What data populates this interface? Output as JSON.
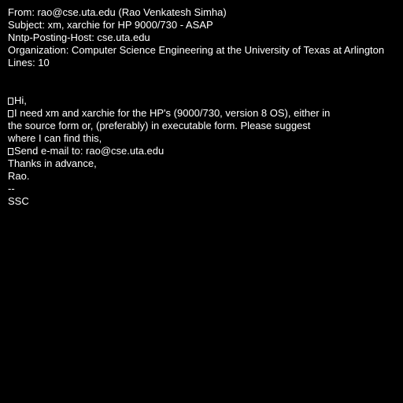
{
  "header": {
    "from": "From: rao@cse.uta.edu (Rao Venkatesh Simha)",
    "subject": "Subject: xm, xarchie for HP 9000/730 - ASAP",
    "nntp_host": "Nntp-Posting-Host: cse.uta.edu",
    "organization": "Organization: Computer Science Engineering at the University of Texas at Arlington",
    "lines": "Lines: 10"
  },
  "body": {
    "greeting": "Hi,",
    "request_1": "I need xm and xarchie for the HP's (9000/730, version 8 OS), either in",
    "request_2": "the source form or, (preferably) in executable form. Please suggest",
    "request_3": "where I can find this,",
    "send_to": "Send e-mail to: rao@cse.uta.edu",
    "thanks": "Thanks in advance,",
    "sign_name": "Rao.",
    "sig_separator": "--",
    "sig_text": "SSC"
  }
}
